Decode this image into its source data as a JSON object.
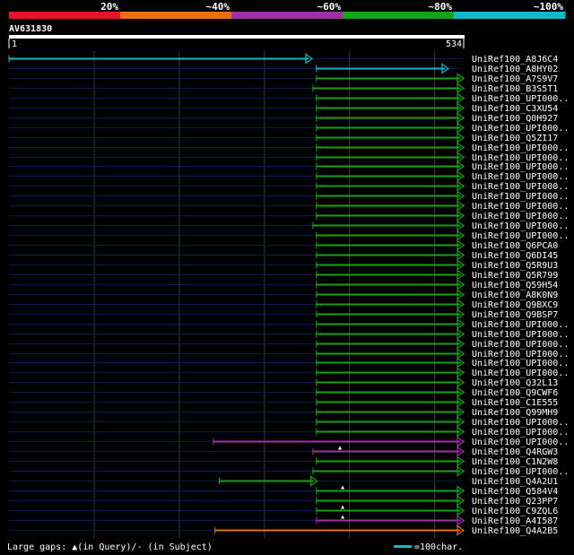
{
  "legend": {
    "segments": [
      {
        "label": "20%",
        "color": "#e8102a"
      },
      {
        "label": "~40%",
        "color": "#e87010"
      },
      {
        "label": "~60%",
        "color": "#a030a8"
      },
      {
        "label": "~80%",
        "color": "#18a018"
      },
      {
        "label": "~100%",
        "color": "#10b8c8"
      }
    ]
  },
  "query": {
    "name": "AV631830",
    "start": "1",
    "end": "534",
    "length": 534
  },
  "colors": {
    "cyan": "#10b8c8",
    "green": "#18a018",
    "magenta": "#a030a8",
    "orange": "#e87010",
    "bg_line": "#0a1a4a",
    "grid": "#3a3a3a"
  },
  "hits": [
    {
      "name": "UniRef100_A8J6C4",
      "start": 1,
      "end": 356,
      "color": "cyan",
      "head": "plain"
    },
    {
      "name": "UniRef100_A8HY02",
      "start": 362,
      "end": 516,
      "color": "cyan",
      "head": "arrow"
    },
    {
      "name": "UniRef100_A7S9V7",
      "start": 362,
      "end": 534,
      "color": "green",
      "head": "arrow"
    },
    {
      "name": "UniRef100_B3S5T1",
      "start": 358,
      "end": 534,
      "color": "green",
      "head": "arrow"
    },
    {
      "name": "UniRef100_UPI000..",
      "start": 362,
      "end": 534,
      "color": "green",
      "head": "arrow"
    },
    {
      "name": "UniRef100_C3XU54",
      "start": 362,
      "end": 534,
      "color": "green",
      "head": "arrow"
    },
    {
      "name": "UniRef100_Q0H927",
      "start": 362,
      "end": 534,
      "color": "green",
      "head": "arrow"
    },
    {
      "name": "UniRef100_UPI000..",
      "start": 362,
      "end": 534,
      "color": "green",
      "head": "arrow"
    },
    {
      "name": "UniRef100_Q5ZI17",
      "start": 362,
      "end": 534,
      "color": "green",
      "head": "arrow"
    },
    {
      "name": "UniRef100_UPI000..",
      "start": 362,
      "end": 534,
      "color": "green",
      "head": "arrow"
    },
    {
      "name": "UniRef100_UPI000..",
      "start": 362,
      "end": 534,
      "color": "green",
      "head": "arrow"
    },
    {
      "name": "UniRef100_UPI000..",
      "start": 362,
      "end": 534,
      "color": "green",
      "head": "arrow"
    },
    {
      "name": "UniRef100_UPI000..",
      "start": 362,
      "end": 534,
      "color": "green",
      "head": "arrow"
    },
    {
      "name": "UniRef100_UPI000..",
      "start": 362,
      "end": 534,
      "color": "green",
      "head": "arrow"
    },
    {
      "name": "UniRef100_UPI000..",
      "start": 362,
      "end": 534,
      "color": "green",
      "head": "arrow"
    },
    {
      "name": "UniRef100_UPI000..",
      "start": 362,
      "end": 534,
      "color": "green",
      "head": "arrow"
    },
    {
      "name": "UniRef100_UPI000..",
      "start": 362,
      "end": 534,
      "color": "green",
      "head": "arrow"
    },
    {
      "name": "UniRef100_UPI000..",
      "start": 358,
      "end": 534,
      "color": "green",
      "head": "arrow"
    },
    {
      "name": "UniRef100_UPI000..",
      "start": 362,
      "end": 534,
      "color": "green",
      "head": "arrow"
    },
    {
      "name": "UniRef100_Q6PCA0",
      "start": 362,
      "end": 534,
      "color": "green",
      "head": "arrow"
    },
    {
      "name": "UniRef100_Q6DI45",
      "start": 362,
      "end": 534,
      "color": "green",
      "head": "arrow"
    },
    {
      "name": "UniRef100_Q5R9U3",
      "start": 362,
      "end": 534,
      "color": "green",
      "head": "arrow"
    },
    {
      "name": "UniRef100_Q5R799",
      "start": 362,
      "end": 534,
      "color": "green",
      "head": "arrow"
    },
    {
      "name": "UniRef100_Q59H54",
      "start": 362,
      "end": 534,
      "color": "green",
      "head": "arrow"
    },
    {
      "name": "UniRef100_A8K0N9",
      "start": 362,
      "end": 534,
      "color": "green",
      "head": "arrow"
    },
    {
      "name": "UniRef100_Q9BXC9",
      "start": 362,
      "end": 534,
      "color": "green",
      "head": "arrow"
    },
    {
      "name": "UniRef100_Q9BSP7",
      "start": 362,
      "end": 534,
      "color": "green",
      "head": "arrow"
    },
    {
      "name": "UniRef100_UPI000..",
      "start": 362,
      "end": 534,
      "color": "green",
      "head": "arrow"
    },
    {
      "name": "UniRef100_UPI000..",
      "start": 362,
      "end": 534,
      "color": "green",
      "head": "arrow"
    },
    {
      "name": "UniRef100_UPI000..",
      "start": 362,
      "end": 534,
      "color": "green",
      "head": "arrow"
    },
    {
      "name": "UniRef100_UPI000..",
      "start": 362,
      "end": 534,
      "color": "green",
      "head": "arrow"
    },
    {
      "name": "UniRef100_UPI000..",
      "start": 362,
      "end": 534,
      "color": "green",
      "head": "arrow"
    },
    {
      "name": "UniRef100_UPI000..",
      "start": 362,
      "end": 534,
      "color": "green",
      "head": "arrow"
    },
    {
      "name": "UniRef100_Q32L13",
      "start": 362,
      "end": 534,
      "color": "green",
      "head": "arrow"
    },
    {
      "name": "UniRef100_Q9CWF6",
      "start": 362,
      "end": 534,
      "color": "green",
      "head": "arrow"
    },
    {
      "name": "UniRef100_C1E555",
      "start": 362,
      "end": 534,
      "color": "green",
      "head": "arrow"
    },
    {
      "name": "UniRef100_Q99MH9",
      "start": 362,
      "end": 534,
      "color": "green",
      "head": "arrow"
    },
    {
      "name": "UniRef100_UPI000..",
      "start": 362,
      "end": 534,
      "color": "green",
      "head": "arrow"
    },
    {
      "name": "UniRef100_UPI000..",
      "start": 362,
      "end": 534,
      "color": "green",
      "head": "arrow"
    },
    {
      "name": "UniRef100_UPI000..",
      "start": 241,
      "end": 534,
      "color": "magenta",
      "head": "arrow"
    },
    {
      "name": "UniRef100_Q4RGW3",
      "start": 358,
      "end": 534,
      "color": "magenta",
      "head": "arrow",
      "gap": true
    },
    {
      "name": "UniRef100_C1N2W8",
      "start": 362,
      "end": 534,
      "color": "green",
      "head": "arrow"
    },
    {
      "name": "UniRef100_UPI000..",
      "start": 358,
      "end": 534,
      "color": "green",
      "head": "arrow"
    },
    {
      "name": "UniRef100_Q4A2U1",
      "start": 248,
      "end": 362,
      "color": "green",
      "head": "arrow"
    },
    {
      "name": "UniRef100_Q584V4",
      "start": 362,
      "end": 534,
      "color": "green",
      "head": "arrow",
      "gap": true
    },
    {
      "name": "UniRef100_Q23PP7",
      "start": 362,
      "end": 534,
      "color": "green",
      "head": "arrow"
    },
    {
      "name": "UniRef100_C9ZQL6",
      "start": 362,
      "end": 534,
      "color": "green",
      "head": "arrow",
      "gap": true
    },
    {
      "name": "UniRef100_A4I587",
      "start": 362,
      "end": 534,
      "color": "magenta",
      "head": "arrow",
      "gap": true
    },
    {
      "name": "UniRef100_Q4A2B5",
      "start": 243,
      "end": 534,
      "color": "orange",
      "head": "arrow"
    }
  ],
  "footer": {
    "gaps_text": "Large gaps: ▲(in Query)/- (in Subject)",
    "scale_text": "=100char."
  }
}
